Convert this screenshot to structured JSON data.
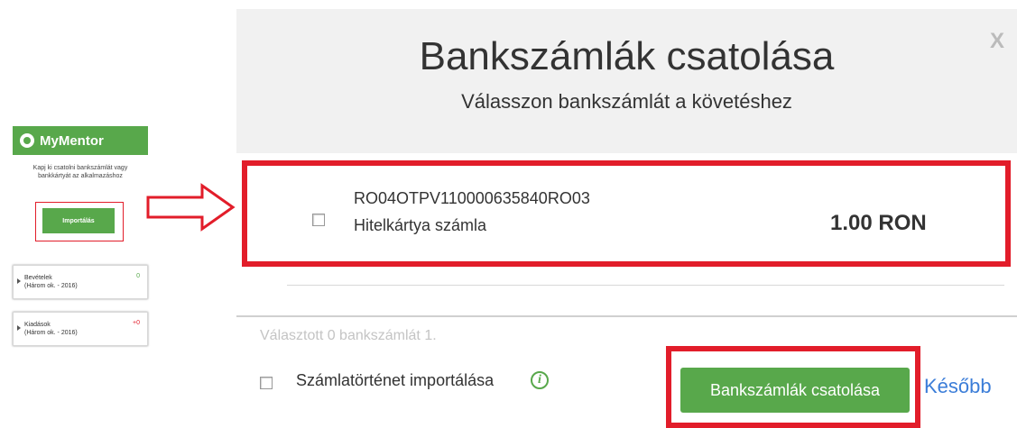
{
  "widget": {
    "brand": "MyMentor",
    "description": "Kapj ki csatolni bankszámlát vagy\nbankkártyát az alkalmazáshoz",
    "button_label": "Importálás",
    "items": [
      {
        "label": "Bevételek\n(Három ok. - 2016)",
        "value": "0"
      },
      {
        "label": "Kiadások\n(Három ok. - 2016)",
        "value": "+0"
      }
    ]
  },
  "modal": {
    "close_label": "X",
    "title": "Bankszámlák csatolása",
    "subtitle": "Válasszon bankszámlát a követéshez",
    "account": {
      "iban": "RO04OTPV110000635840RO03",
      "type": "Hitelkártya számla",
      "balance": "1.00 RON",
      "checked": false
    },
    "selected_count_text": "Választott 0 bankszámlát 1.",
    "import_history_label": "Számlatörténet importálása",
    "info_icon_label": "i",
    "connect_button": "Bankszámlák csatolása",
    "later_link": "Később"
  },
  "colors": {
    "accent_green": "#58a84b",
    "highlight_red": "#e21d2a",
    "link_blue": "#3b7dd8"
  }
}
